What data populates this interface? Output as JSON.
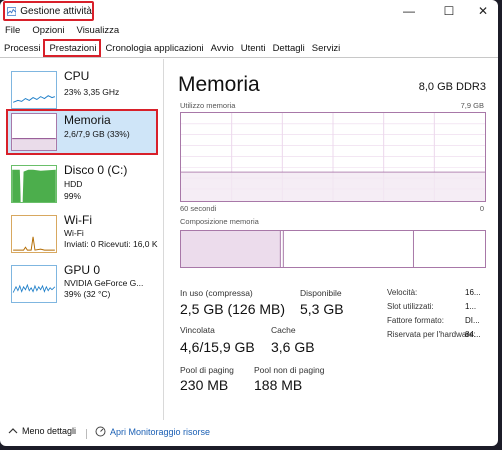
{
  "window": {
    "title": "Gestione attività",
    "minimize": "—",
    "maximize": "☐",
    "close": "✕"
  },
  "menu": [
    "File",
    "Opzioni",
    "Visualizza"
  ],
  "tabs": [
    "Processi",
    "Prestazioni",
    "Cronologia applicazioni",
    "Avvio",
    "Utenti",
    "Dettagli",
    "Servizi"
  ],
  "active_tab": "Prestazioni",
  "resources": [
    {
      "name": "CPU",
      "lines": [
        "23% 3,35 GHz"
      ]
    },
    {
      "name": "Memoria",
      "lines": [
        "2,6/7,9 GB (33%)"
      ]
    },
    {
      "name": "Disco 0 (C:)",
      "lines": [
        "HDD",
        "99%"
      ]
    },
    {
      "name": "Wi-Fi",
      "lines": [
        "Wi-Fi",
        "Inviati: 0 Ricevuti: 16,0 K"
      ]
    },
    {
      "name": "GPU 0",
      "lines": [
        "NVIDIA GeForce G...",
        "39% (32 °C)"
      ]
    }
  ],
  "detail": {
    "title": "Memoria",
    "capacity": "8,0 GB DDR3",
    "usage_label": "Utilizzo memoria",
    "usage_max": "7,9 GB",
    "time_left": "60 secondi",
    "time_right": "0",
    "composition_label": "Composizione memoria",
    "stats": [
      {
        "label": "In uso (compressa)",
        "value": "2,5 GB (126 MB)"
      },
      {
        "label": "Disponibile",
        "value": "5,3 GB"
      },
      {
        "label": "Vincolata",
        "value": "4,6/15,9 GB"
      },
      {
        "label": "Cache",
        "value": "3,6 GB"
      },
      {
        "label": "Pool di paging",
        "value": "230 MB"
      },
      {
        "label": "Pool non di paging",
        "value": "188 MB"
      }
    ],
    "kv": [
      {
        "label": "Velocità:",
        "value": "16..."
      },
      {
        "label": "Slot utilizzati:",
        "value": "1..."
      },
      {
        "label": "Fattore formato:",
        "value": "DI..."
      },
      {
        "label": "Riservata per l'hardware:",
        "value": "84..."
      }
    ]
  },
  "footer": {
    "less_details": "Meno dettagli",
    "open_monitor": "Apri Monitoraggio risorse"
  },
  "colors": {
    "memory_line": "#8b4a8b",
    "disk_fill": "#4cae4c",
    "cpu_line": "#1f7fc9",
    "gpu_line": "#1f7fc9",
    "wifi_line": "#b36b00",
    "highlight": "#d8202a"
  }
}
